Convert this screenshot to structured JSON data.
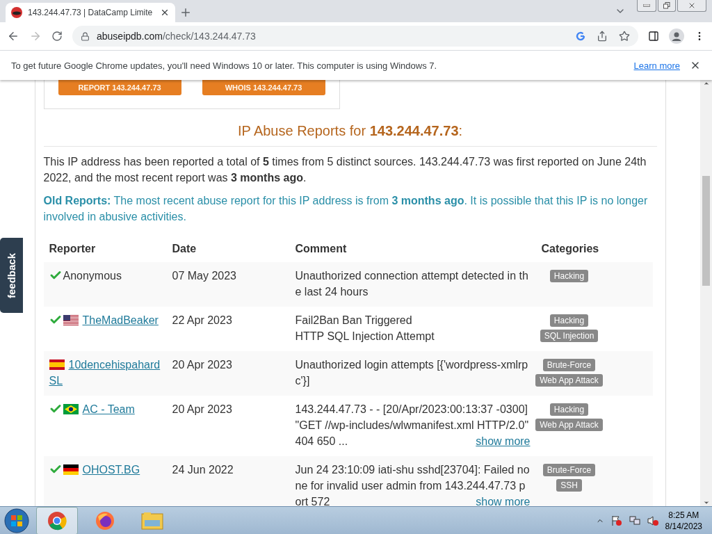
{
  "browser": {
    "tab_title": "143.244.47.73 | DataCamp Limite",
    "url_host": "abuseipdb.com",
    "url_path": "/check/143.244.47.73"
  },
  "infobar": {
    "message": "To get future Google Chrome updates, you'll need Windows 10 or later. This computer is using Windows 7.",
    "link": "Learn more"
  },
  "feedback_tab": "feedback",
  "page": {
    "buttons": [
      "REPORT 143.244.47.73",
      "WHOIS 143.244.47.73"
    ],
    "heading": "IP Abuse Reports for **143.244.47.73**:",
    "summary": "This IP address has been reported a total of **5** times from 5 distinct sources. 143.244.47.73 was first reported on June 24th 2022, and the most recent report was **3 months ago**.",
    "notice": "**Old Reports:** The most recent abuse report for this IP address is from **3 months ago**. It is possible that this IP is no longer involved in abusive activities.",
    "columns": [
      "Reporter",
      "Date",
      "Comment",
      "Categories"
    ],
    "rows": [
      {
        "verified": true,
        "kind": "plain",
        "linked": false,
        "reporter": "Anonymous",
        "date": "07 May 2023",
        "comment": "Unauthorized connection attempt detected in the last 24 hours",
        "categories": [
          "Hacking"
        ]
      },
      {
        "verified": true,
        "kind": "us",
        "linked": true,
        "reporter": "TheMadBeaker",
        "date": "22 Apr 2023",
        "comment": "Fail2Ban Ban Triggered\nHTTP SQL Injection Attempt",
        "categories": [
          "Hacking",
          "SQL Injection"
        ]
      },
      {
        "verified": false,
        "kind": "es",
        "linked": true,
        "reporter": "10dencehispahard SL",
        "date": "20 Apr 2023",
        "comment": "Unauthorized login attempts [{'wordpress-xmlrpc'}]",
        "categories": [
          "Brute-Force",
          "Web App Attack"
        ]
      },
      {
        "verified": true,
        "kind": "br",
        "linked": true,
        "reporter": "AC - Team",
        "date": "20 Apr 2023",
        "comment": "143.244.47.73 - - [20/Apr/2023:00:13:37 -0300] \"GET //wp-includes/wlwmanifest.xml HTTP/2.0\" 404 650 ...",
        "show_more": "show more",
        "categories": [
          "Hacking",
          "Web App Attack"
        ]
      },
      {
        "verified": true,
        "kind": "de",
        "linked": true,
        "reporter": "OHOST.BG",
        "date": "24 Jun 2022",
        "comment": "Jun 24 23:10:09 iati-shu sshd[23704]: Failed none for invalid user admin from 143.244.47.73 port 572",
        "show_more": "show more",
        "categories": [
          "Brute-Force",
          "SSH"
        ]
      }
    ]
  },
  "taskbar": {
    "time": "8:25 AM",
    "date": "8/14/2023"
  }
}
